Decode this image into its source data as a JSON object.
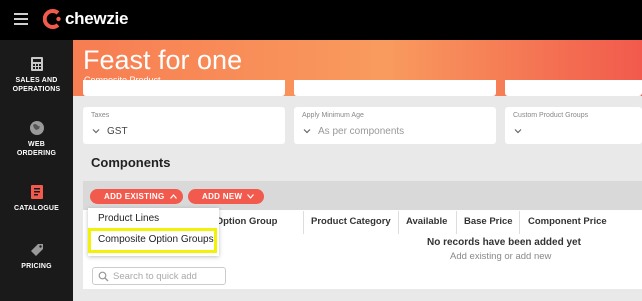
{
  "app": {
    "brand": "chewzie",
    "brand_color": "#f15a4c"
  },
  "sidebar": {
    "items": [
      {
        "label_line1": "SALES AND",
        "label_line2": "OPERATIONS",
        "icon": "register-icon"
      },
      {
        "label_line1": "WEB",
        "label_line2": "ORDERING",
        "icon": "globe-icon"
      },
      {
        "label_line1": "CATALOGUE",
        "label_line2": "",
        "icon": "catalogue-icon",
        "active": true
      },
      {
        "label_line1": "PRICING",
        "label_line2": "",
        "icon": "tag-icon"
      }
    ]
  },
  "header": {
    "title": "Feast for one",
    "subtitle": "Composite Product"
  },
  "fields": [
    {
      "label": "Taxes",
      "value": "GST"
    },
    {
      "label": "Apply Minimum Age",
      "placeholder": "As per components"
    },
    {
      "label": "Custom Product Groups",
      "value": ""
    }
  ],
  "components": {
    "title": "Components",
    "add_existing_label": "ADD EXISTING",
    "add_new_label": "ADD NEW",
    "columns": [
      "ite Option Group",
      "Product Category",
      "Available",
      "Base Price",
      "Component Price"
    ],
    "empty_title": "No records have been added yet",
    "empty_sub": "Add existing or add new",
    "quick_add_placeholder": "Search to quick add"
  },
  "dropdown": {
    "items": [
      "Product Lines",
      "Composite Option Groups"
    ],
    "highlighted": "Composite Option Groups"
  }
}
